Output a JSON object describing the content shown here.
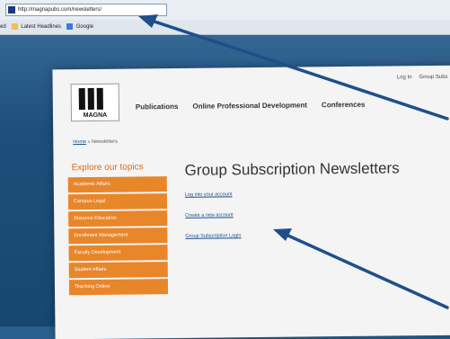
{
  "browser": {
    "url": "http://magnapubs.com/newsletters/",
    "bookmarks": [
      "ed",
      "Latest Headlines",
      "Google"
    ]
  },
  "site": {
    "logo_text": "MAGNA",
    "top_links": [
      "Log In",
      "Group Subs"
    ],
    "nav": [
      "Publications",
      "Online Professional Development",
      "Conferences"
    ],
    "breadcrumb": {
      "home": "Home",
      "separator": "»",
      "current": "Newsletters"
    }
  },
  "sidebar": {
    "title": "Explore our topics",
    "items": [
      "Academic Affairs",
      "Campus Legal",
      "Distance Education",
      "Enrollment Management",
      "Faculty Development",
      "Student Affairs",
      "Teaching Online"
    ]
  },
  "main": {
    "title": "Group Subscription Newsletters",
    "links": [
      "Log into your account",
      "Create a new account",
      "Group Subscription Login"
    ]
  },
  "colors": {
    "sidebar_orange": "#e8862a",
    "title_orange": "#e06a12",
    "arrow_blue": "#1f4f8a"
  },
  "icons": [
    "favicon-icon",
    "folder-icon",
    "google-icon",
    "arrow-icon"
  ]
}
